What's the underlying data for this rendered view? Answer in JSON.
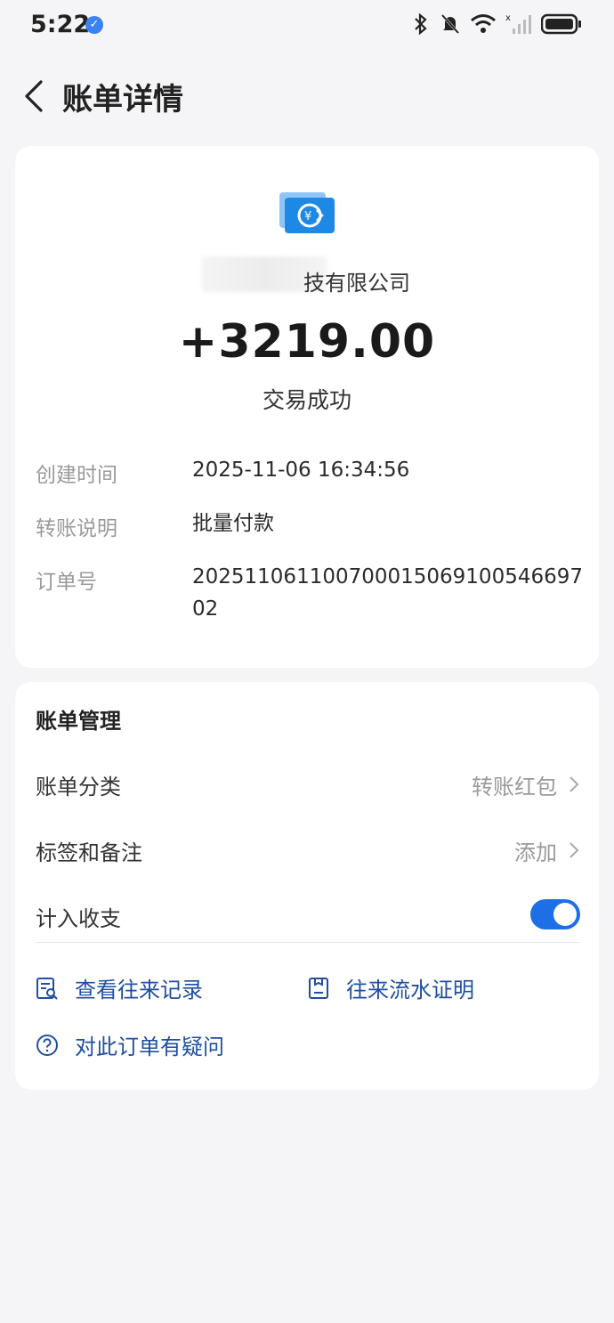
{
  "status_bar": {
    "time": "5:22"
  },
  "header": {
    "title": "账单详情"
  },
  "bill": {
    "payee": "技有限公司",
    "amount": "+3219.00",
    "status": "交易成功",
    "details": [
      {
        "label": "创建时间",
        "value": "2025-11-06 16:34:56"
      },
      {
        "label": "转账说明",
        "value": "批量付款"
      },
      {
        "label": "订单号",
        "value": "20251106110070001506910054669702"
      }
    ]
  },
  "management": {
    "title": "账单管理",
    "category": {
      "label": "账单分类",
      "value": "转账红包"
    },
    "tags": {
      "label": "标签和备注",
      "value": "添加"
    },
    "include": {
      "label": "计入收支",
      "enabled": true
    },
    "links": {
      "history": "查看往来记录",
      "proof": "往来流水证明",
      "question": "对此订单有疑问"
    }
  },
  "colors": {
    "accent": "#1e6fe6",
    "link": "#1f4fa0"
  }
}
